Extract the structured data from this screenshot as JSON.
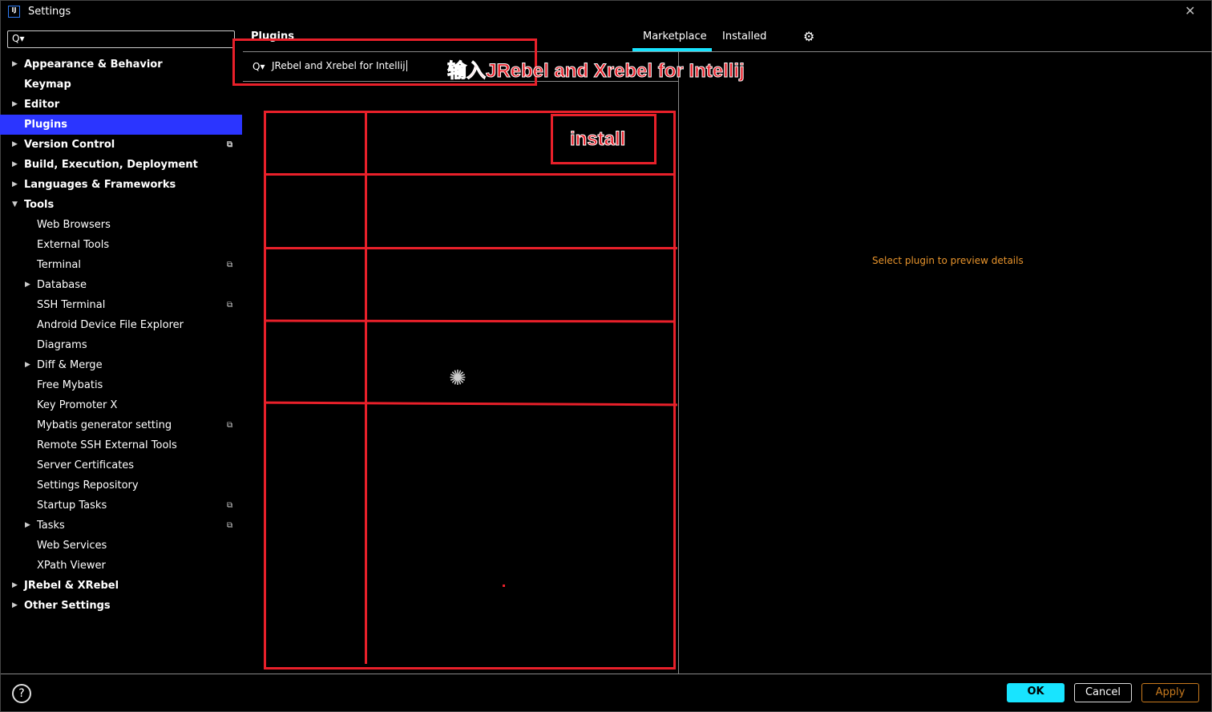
{
  "window": {
    "title": "Settings",
    "logo": "IJ"
  },
  "search": {
    "icon": "Q▾",
    "value": ""
  },
  "sidebar": {
    "items": [
      {
        "label": "Appearance & Behavior",
        "level": 0,
        "arrow": "right"
      },
      {
        "label": "Keymap",
        "level": 0
      },
      {
        "label": "Editor",
        "level": 0,
        "arrow": "right"
      },
      {
        "label": "Plugins",
        "level": 0,
        "selected": true
      },
      {
        "label": "Version Control",
        "level": 0,
        "arrow": "right",
        "copy": true
      },
      {
        "label": "Build, Execution, Deployment",
        "level": 0,
        "arrow": "right"
      },
      {
        "label": "Languages & Frameworks",
        "level": 0,
        "arrow": "right"
      },
      {
        "label": "Tools",
        "level": 0,
        "arrow": "down"
      },
      {
        "label": "Web Browsers",
        "level": 1
      },
      {
        "label": "External Tools",
        "level": 1
      },
      {
        "label": "Terminal",
        "level": 1,
        "copy": true
      },
      {
        "label": "Database",
        "level": 1,
        "arrow": "right"
      },
      {
        "label": "SSH Terminal",
        "level": 1,
        "copy": true
      },
      {
        "label": "Android Device File Explorer",
        "level": 1
      },
      {
        "label": "Diagrams",
        "level": 1
      },
      {
        "label": "Diff & Merge",
        "level": 1,
        "arrow": "right"
      },
      {
        "label": "Free Mybatis",
        "level": 1
      },
      {
        "label": "Key Promoter X",
        "level": 1
      },
      {
        "label": "Mybatis generator setting",
        "level": 1,
        "copy": true
      },
      {
        "label": "Remote SSH External Tools",
        "level": 1
      },
      {
        "label": "Server Certificates",
        "level": 1
      },
      {
        "label": "Settings Repository",
        "level": 1
      },
      {
        "label": "Startup Tasks",
        "level": 1,
        "copy": true
      },
      {
        "label": "Tasks",
        "level": 1,
        "arrow": "right",
        "copy": true
      },
      {
        "label": "Web Services",
        "level": 1
      },
      {
        "label": "XPath Viewer",
        "level": 1
      },
      {
        "label": "JRebel & XRebel",
        "level": 0,
        "arrow": "right"
      },
      {
        "label": "Other Settings",
        "level": 0,
        "arrow": "right"
      }
    ]
  },
  "plugins": {
    "heading": "Plugins",
    "tabs": [
      {
        "label": "Marketplace",
        "active": true
      },
      {
        "label": "Installed"
      }
    ],
    "search_icon": "Q▾",
    "search_value": "JRebel and Xrebel for Intellij",
    "preview_text": "Select plugin to preview details",
    "gear_icon": "gear-icon"
  },
  "annotations": {
    "search_note": "输入JRebel and Xrebel for Intellij",
    "install_note": "install"
  },
  "footer": {
    "help": "?",
    "ok": "OK",
    "cancel": "Cancel",
    "apply": "Apply"
  },
  "colors": {
    "accent": "#18e4ff",
    "selection": "#2b35ff",
    "annotation": "#e8202a",
    "apply": "#c87a1e",
    "preview": "#e8942c"
  }
}
